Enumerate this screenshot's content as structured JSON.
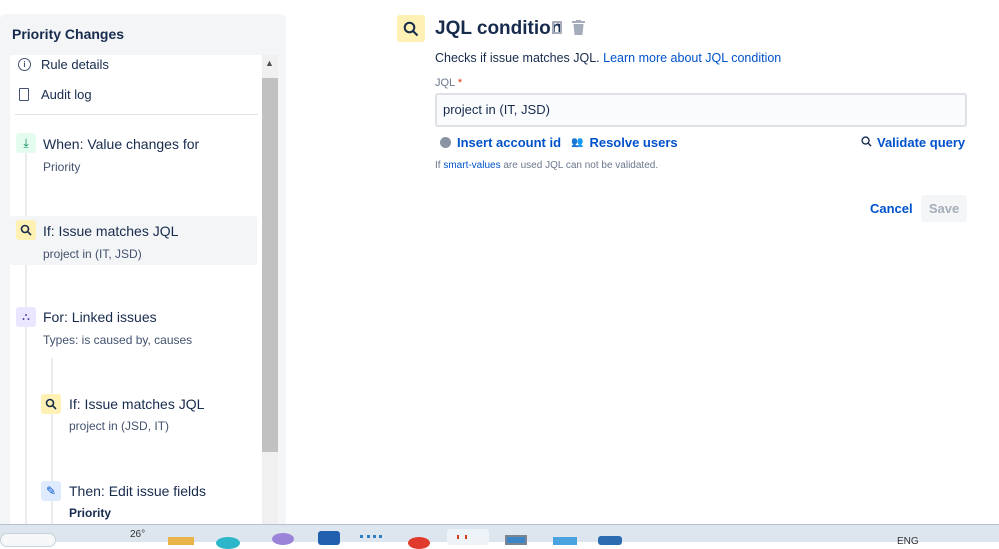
{
  "sidebar": {
    "title": "Priority Changes",
    "nav": [
      {
        "label": "Rule details",
        "icon": "info-icon"
      },
      {
        "label": "Audit log",
        "icon": "document-icon"
      }
    ],
    "steps": [
      {
        "title": "When: Value changes for",
        "subtitle": "Priority",
        "icon": "trigger-icon",
        "color": "#e3fcef"
      },
      {
        "title": "If: Issue matches JQL",
        "subtitle": "project in (IT, JSD)",
        "icon": "search-icon",
        "color": "#fff0b3"
      },
      {
        "title": "For: Linked issues",
        "subtitle": "Types: is caused by, causes",
        "icon": "branch-icon",
        "color": "#eae6ff"
      },
      {
        "title": "If: Issue matches JQL",
        "subtitle": "project in (JSD, IT)",
        "icon": "search-icon",
        "color": "#fff0b3"
      },
      {
        "title": "Then: Edit issue fields",
        "subtitle": "Priority",
        "icon": "pencil-icon",
        "color": "#deebff"
      }
    ]
  },
  "panel": {
    "title": "JQL condition",
    "description": "Checks if issue matches JQL.",
    "learn_more": "Learn more about JQL condition",
    "jql_label": "JQL",
    "required": "*",
    "jql_value": "project in (IT, JSD)",
    "insert_account": "Insert account id",
    "resolve_users": "Resolve users",
    "validate": "Validate query",
    "hint_prefix": "If",
    "hint_link": "smart-values",
    "hint_suffix": "are used JQL can not be validated.",
    "cancel": "Cancel",
    "save": "Save"
  },
  "taskbar": {
    "weather": "26°",
    "language": "ENG"
  }
}
